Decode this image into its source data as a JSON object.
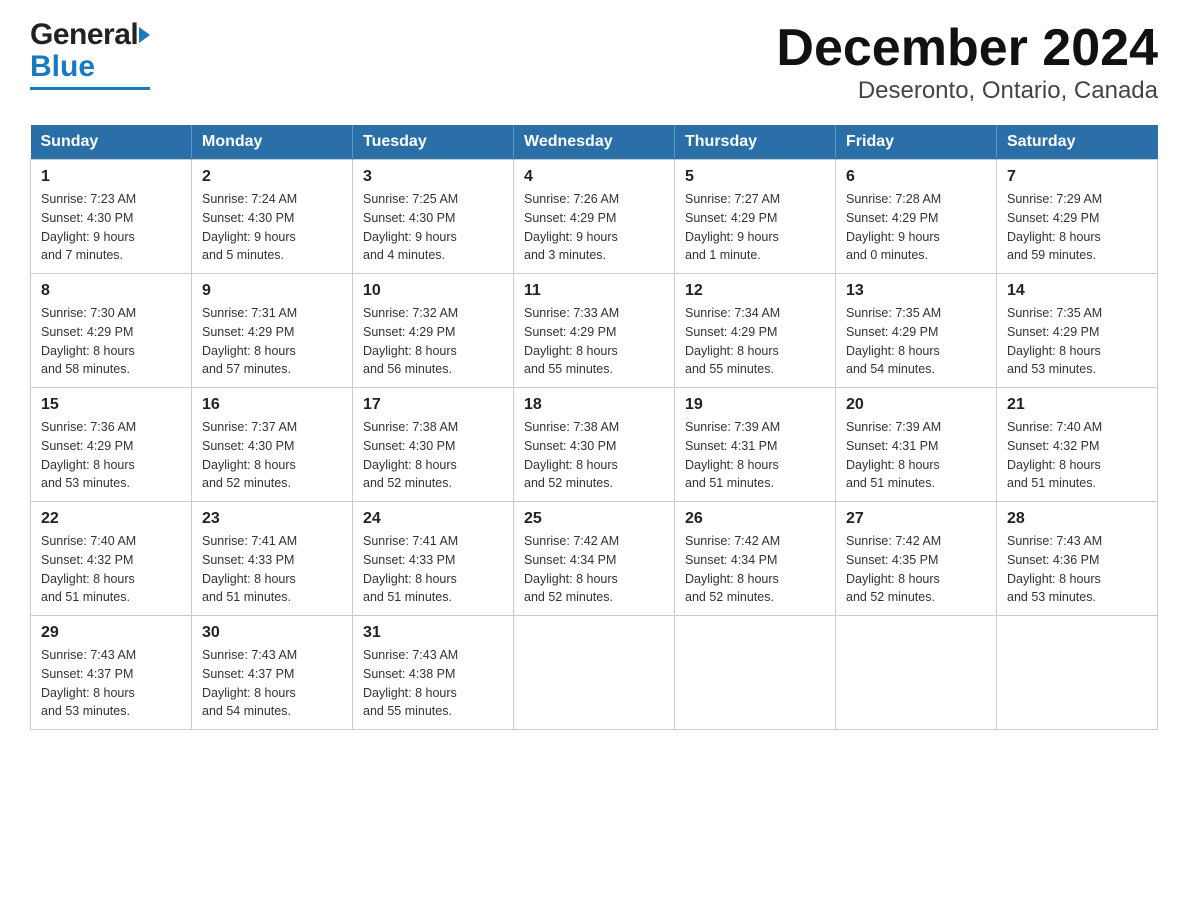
{
  "header": {
    "logo_general": "General",
    "logo_blue": "Blue",
    "title": "December 2024",
    "subtitle": "Deseronto, Ontario, Canada"
  },
  "days_of_week": [
    "Sunday",
    "Monday",
    "Tuesday",
    "Wednesday",
    "Thursday",
    "Friday",
    "Saturday"
  ],
  "weeks": [
    [
      {
        "day": "1",
        "sunrise": "7:23 AM",
        "sunset": "4:30 PM",
        "daylight": "9 hours and 7 minutes."
      },
      {
        "day": "2",
        "sunrise": "7:24 AM",
        "sunset": "4:30 PM",
        "daylight": "9 hours and 5 minutes."
      },
      {
        "day": "3",
        "sunrise": "7:25 AM",
        "sunset": "4:30 PM",
        "daylight": "9 hours and 4 minutes."
      },
      {
        "day": "4",
        "sunrise": "7:26 AM",
        "sunset": "4:29 PM",
        "daylight": "9 hours and 3 minutes."
      },
      {
        "day": "5",
        "sunrise": "7:27 AM",
        "sunset": "4:29 PM",
        "daylight": "9 hours and 1 minute."
      },
      {
        "day": "6",
        "sunrise": "7:28 AM",
        "sunset": "4:29 PM",
        "daylight": "9 hours and 0 minutes."
      },
      {
        "day": "7",
        "sunrise": "7:29 AM",
        "sunset": "4:29 PM",
        "daylight": "8 hours and 59 minutes."
      }
    ],
    [
      {
        "day": "8",
        "sunrise": "7:30 AM",
        "sunset": "4:29 PM",
        "daylight": "8 hours and 58 minutes."
      },
      {
        "day": "9",
        "sunrise": "7:31 AM",
        "sunset": "4:29 PM",
        "daylight": "8 hours and 57 minutes."
      },
      {
        "day": "10",
        "sunrise": "7:32 AM",
        "sunset": "4:29 PM",
        "daylight": "8 hours and 56 minutes."
      },
      {
        "day": "11",
        "sunrise": "7:33 AM",
        "sunset": "4:29 PM",
        "daylight": "8 hours and 55 minutes."
      },
      {
        "day": "12",
        "sunrise": "7:34 AM",
        "sunset": "4:29 PM",
        "daylight": "8 hours and 55 minutes."
      },
      {
        "day": "13",
        "sunrise": "7:35 AM",
        "sunset": "4:29 PM",
        "daylight": "8 hours and 54 minutes."
      },
      {
        "day": "14",
        "sunrise": "7:35 AM",
        "sunset": "4:29 PM",
        "daylight": "8 hours and 53 minutes."
      }
    ],
    [
      {
        "day": "15",
        "sunrise": "7:36 AM",
        "sunset": "4:29 PM",
        "daylight": "8 hours and 53 minutes."
      },
      {
        "day": "16",
        "sunrise": "7:37 AM",
        "sunset": "4:30 PM",
        "daylight": "8 hours and 52 minutes."
      },
      {
        "day": "17",
        "sunrise": "7:38 AM",
        "sunset": "4:30 PM",
        "daylight": "8 hours and 52 minutes."
      },
      {
        "day": "18",
        "sunrise": "7:38 AM",
        "sunset": "4:30 PM",
        "daylight": "8 hours and 52 minutes."
      },
      {
        "day": "19",
        "sunrise": "7:39 AM",
        "sunset": "4:31 PM",
        "daylight": "8 hours and 51 minutes."
      },
      {
        "day": "20",
        "sunrise": "7:39 AM",
        "sunset": "4:31 PM",
        "daylight": "8 hours and 51 minutes."
      },
      {
        "day": "21",
        "sunrise": "7:40 AM",
        "sunset": "4:32 PM",
        "daylight": "8 hours and 51 minutes."
      }
    ],
    [
      {
        "day": "22",
        "sunrise": "7:40 AM",
        "sunset": "4:32 PM",
        "daylight": "8 hours and 51 minutes."
      },
      {
        "day": "23",
        "sunrise": "7:41 AM",
        "sunset": "4:33 PM",
        "daylight": "8 hours and 51 minutes."
      },
      {
        "day": "24",
        "sunrise": "7:41 AM",
        "sunset": "4:33 PM",
        "daylight": "8 hours and 51 minutes."
      },
      {
        "day": "25",
        "sunrise": "7:42 AM",
        "sunset": "4:34 PM",
        "daylight": "8 hours and 52 minutes."
      },
      {
        "day": "26",
        "sunrise": "7:42 AM",
        "sunset": "4:34 PM",
        "daylight": "8 hours and 52 minutes."
      },
      {
        "day": "27",
        "sunrise": "7:42 AM",
        "sunset": "4:35 PM",
        "daylight": "8 hours and 52 minutes."
      },
      {
        "day": "28",
        "sunrise": "7:43 AM",
        "sunset": "4:36 PM",
        "daylight": "8 hours and 53 minutes."
      }
    ],
    [
      {
        "day": "29",
        "sunrise": "7:43 AM",
        "sunset": "4:37 PM",
        "daylight": "8 hours and 53 minutes."
      },
      {
        "day": "30",
        "sunrise": "7:43 AM",
        "sunset": "4:37 PM",
        "daylight": "8 hours and 54 minutes."
      },
      {
        "day": "31",
        "sunrise": "7:43 AM",
        "sunset": "4:38 PM",
        "daylight": "8 hours and 55 minutes."
      },
      null,
      null,
      null,
      null
    ]
  ],
  "labels": {
    "sunrise": "Sunrise:",
    "sunset": "Sunset:",
    "daylight": "Daylight:"
  }
}
